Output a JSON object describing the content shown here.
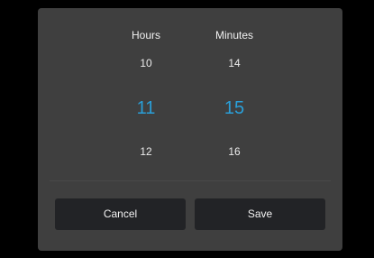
{
  "picker": {
    "hours": {
      "header": "Hours",
      "prev": "10",
      "selected": "11",
      "next": "12"
    },
    "minutes": {
      "header": "Minutes",
      "prev": "14",
      "selected": "15",
      "next": "16"
    },
    "accent_color": "#2a9fd8"
  },
  "actions": {
    "cancel_label": "Cancel",
    "save_label": "Save"
  }
}
